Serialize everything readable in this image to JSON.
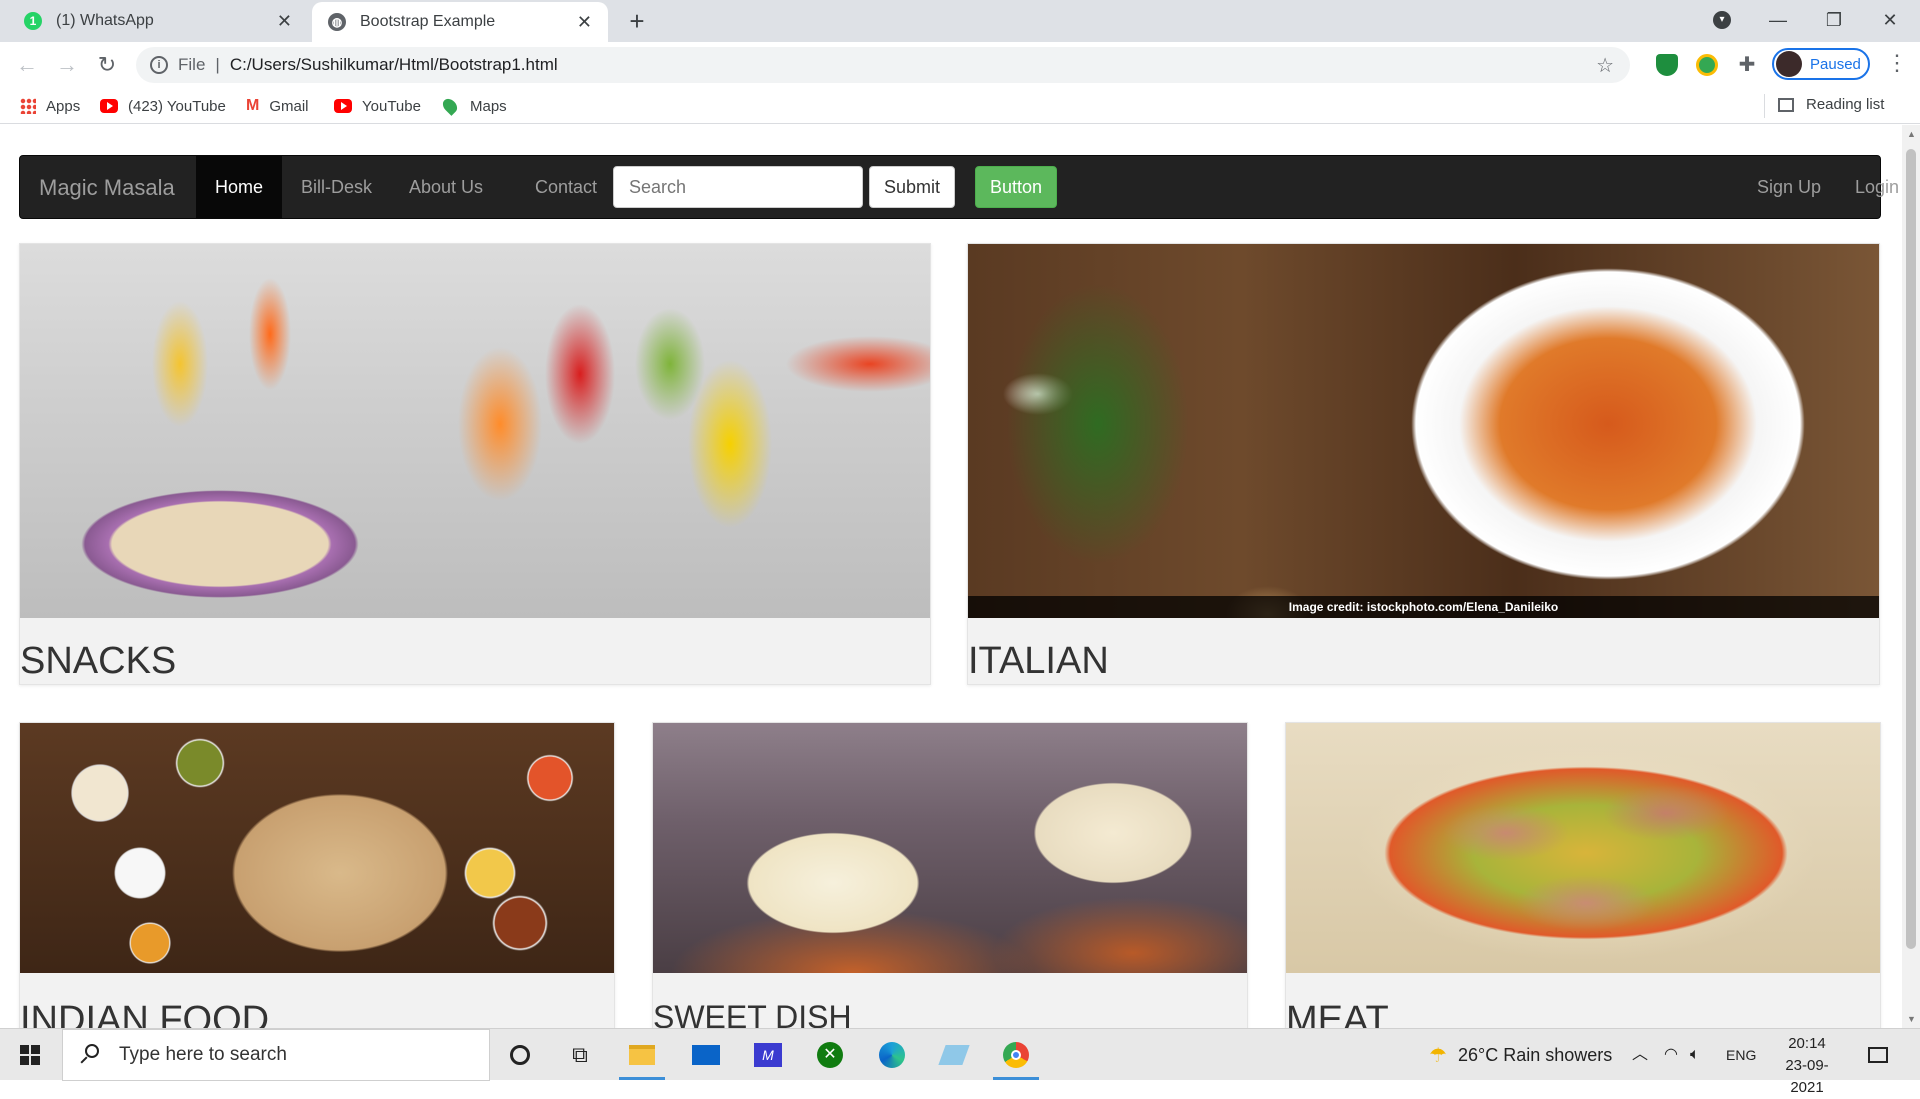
{
  "browser": {
    "tabs": [
      {
        "label": "(1) WhatsApp",
        "badge": "1"
      },
      {
        "label": "Bootstrap Example"
      }
    ],
    "address": {
      "scheme": "File",
      "url": "C:/Users/Sushilkumar/Html/Bootstrap1.html"
    },
    "profile_label": "Paused",
    "bookmarks": [
      "Apps",
      "(423) YouTube",
      "Gmail",
      "YouTube",
      "Maps"
    ],
    "reading_list": "Reading list"
  },
  "page": {
    "brand": "Magic Masala",
    "nav": [
      "Home",
      "Bill-Desk",
      "About Us",
      "Contact"
    ],
    "search_placeholder": "Search",
    "submit_label": "Submit",
    "button_label": "Button",
    "right_nav": [
      "Sign Up",
      "Login"
    ],
    "cards": [
      {
        "title": "SNACKS"
      },
      {
        "title": "ITALIAN",
        "credit": "Image credit: istockphoto.com/Elena_Danileiko"
      },
      {
        "title": "INDIAN FOOD"
      },
      {
        "title": "SWEET DISH"
      },
      {
        "title": "MEAT"
      }
    ]
  },
  "taskbar": {
    "search_placeholder": "Type here to search",
    "weather": "26°C  Rain showers",
    "language": "ENG",
    "time": "20:14",
    "date": "23-09-2021"
  },
  "colors": {
    "navbar_bg": "#222222",
    "button_green": "#5cb85c",
    "chrome_tabstrip": "#dee1e6",
    "profile_accent": "#1a73e8"
  }
}
